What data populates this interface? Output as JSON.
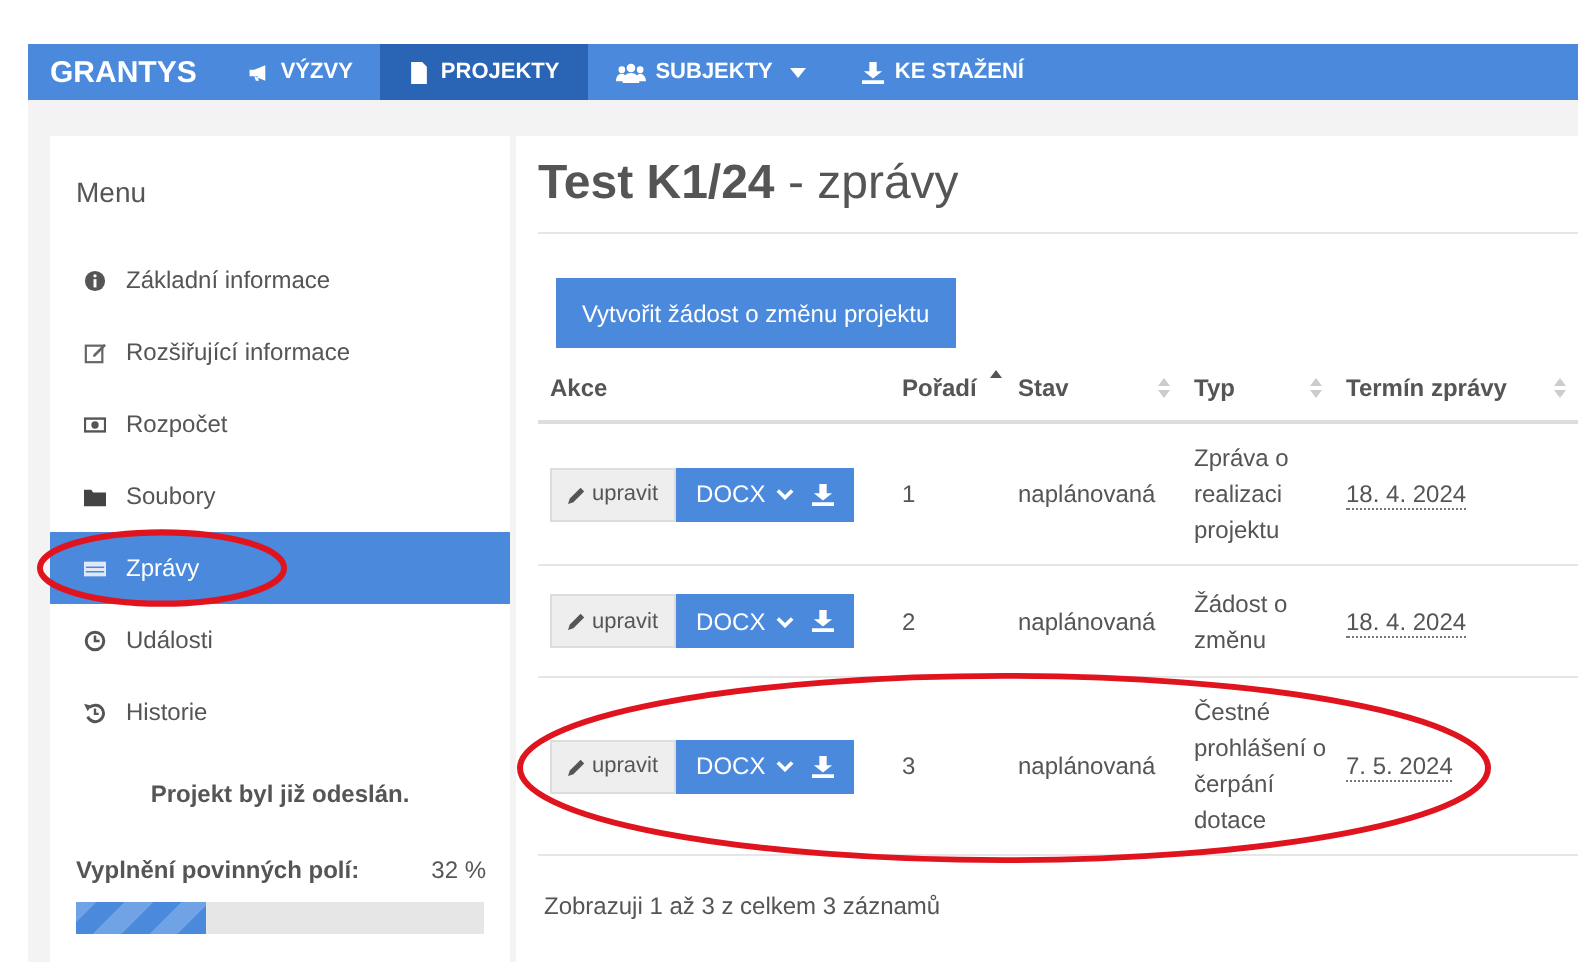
{
  "navbar": {
    "brand": "GRANTYS",
    "items": [
      {
        "label": "VÝZVY",
        "selected": false,
        "has_menu": false
      },
      {
        "label": "PROJEKTY",
        "selected": true,
        "has_menu": false
      },
      {
        "label": "SUBJEKTY",
        "selected": false,
        "has_menu": true
      },
      {
        "label": "KE STAŽENÍ",
        "selected": false,
        "has_menu": false
      }
    ]
  },
  "sidebar": {
    "title": "Menu",
    "items": [
      {
        "label": "Základní informace",
        "selected": false,
        "circled": false
      },
      {
        "label": "Rozšiřující informace",
        "selected": false,
        "circled": false
      },
      {
        "label": "Rozpočet",
        "selected": false,
        "circled": false
      },
      {
        "label": "Soubory",
        "selected": false,
        "circled": false
      },
      {
        "label": "Zprávy",
        "selected": true,
        "circled": true
      },
      {
        "label": "Události",
        "selected": false,
        "circled": false
      },
      {
        "label": "Historie",
        "selected": false,
        "circled": false
      }
    ],
    "notice": "Projekt byl již odeslán.",
    "progress": {
      "label": "Vyplnění povinných polí:",
      "reading": "32 %",
      "level": 0.32
    }
  },
  "main": {
    "title": "**Test K1/24** - zprávy",
    "create_button": "Vytvořit žádost o změnu projektu",
    "table": {
      "columns": [
        {
          "label": "Akce",
          "sortable": false,
          "sorted": false
        },
        {
          "label": "Pořadí",
          "sortable": true,
          "sorted": true
        },
        {
          "label": "Stav",
          "sortable": true,
          "sorted": false
        },
        {
          "label": "Typ",
          "sortable": true,
          "sorted": false
        },
        {
          "label": "Termín zprávy",
          "sortable": true,
          "sorted": false
        }
      ],
      "rows": [
        {
          "edit": "upravit",
          "format": "DOCX",
          "order": "1",
          "status": "naplánovaná",
          "type": "Zpráva o realizaci projektu",
          "deadline": "18. 4. 2024",
          "circled": false
        },
        {
          "edit": "upravit",
          "format": "DOCX",
          "order": "2",
          "status": "naplánovaná",
          "type": "Žádost o změnu",
          "deadline": "18. 4. 2024",
          "circled": false
        },
        {
          "edit": "upravit",
          "format": "DOCX",
          "order": "3",
          "status": "naplánovaná",
          "type": "Čestné prohlášení o čerpání dotace",
          "deadline": "7. 5. 2024",
          "circled": true
        }
      ]
    },
    "footer": "Zobrazuji 1 až 3 z celkem 3 záznamů"
  }
}
